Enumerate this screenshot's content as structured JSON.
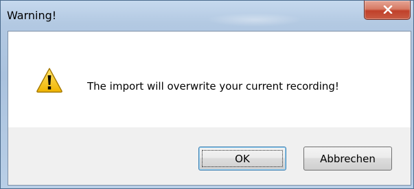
{
  "window": {
    "title": "Warning!"
  },
  "message": {
    "text": "The import will overwrite your current recording!"
  },
  "buttons": {
    "ok_label": "OK",
    "cancel_label": "Abbrechen"
  },
  "icons": {
    "warning": "warning-triangle-icon",
    "close": "close-icon"
  },
  "colors": {
    "close_button": "#c0412a",
    "warning_fill": "#f5c518",
    "ok_focus_border": "#3c7fb1"
  }
}
